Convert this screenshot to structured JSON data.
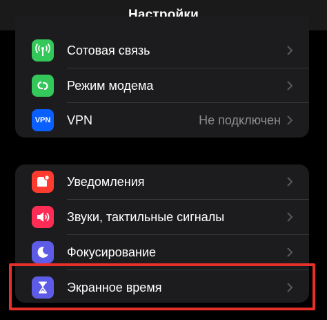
{
  "header": {
    "title": "Настройки"
  },
  "group1": [
    {
      "label": "Сотовая связь",
      "icon": "antenna-icon",
      "color": "#34c759"
    },
    {
      "label": "Режим модема",
      "icon": "link-icon",
      "color": "#34c759"
    },
    {
      "label": "VPN",
      "icon": "vpn-icon",
      "icon_text": "VPN",
      "color": "#0a60ff",
      "value": "Не подключен"
    }
  ],
  "group2": [
    {
      "label": "Уведомления",
      "icon": "bell-icon",
      "color": "#ff3b30"
    },
    {
      "label": "Звуки, тактильные сигналы",
      "icon": "speaker-icon",
      "color": "#ff2d55"
    },
    {
      "label": "Фокусирование",
      "icon": "moon-icon",
      "color": "#5e5ce6"
    },
    {
      "label": "Экранное время",
      "icon": "hourglass-icon",
      "color": "#5e5ce6"
    }
  ],
  "highlight_color": "#e8302a"
}
